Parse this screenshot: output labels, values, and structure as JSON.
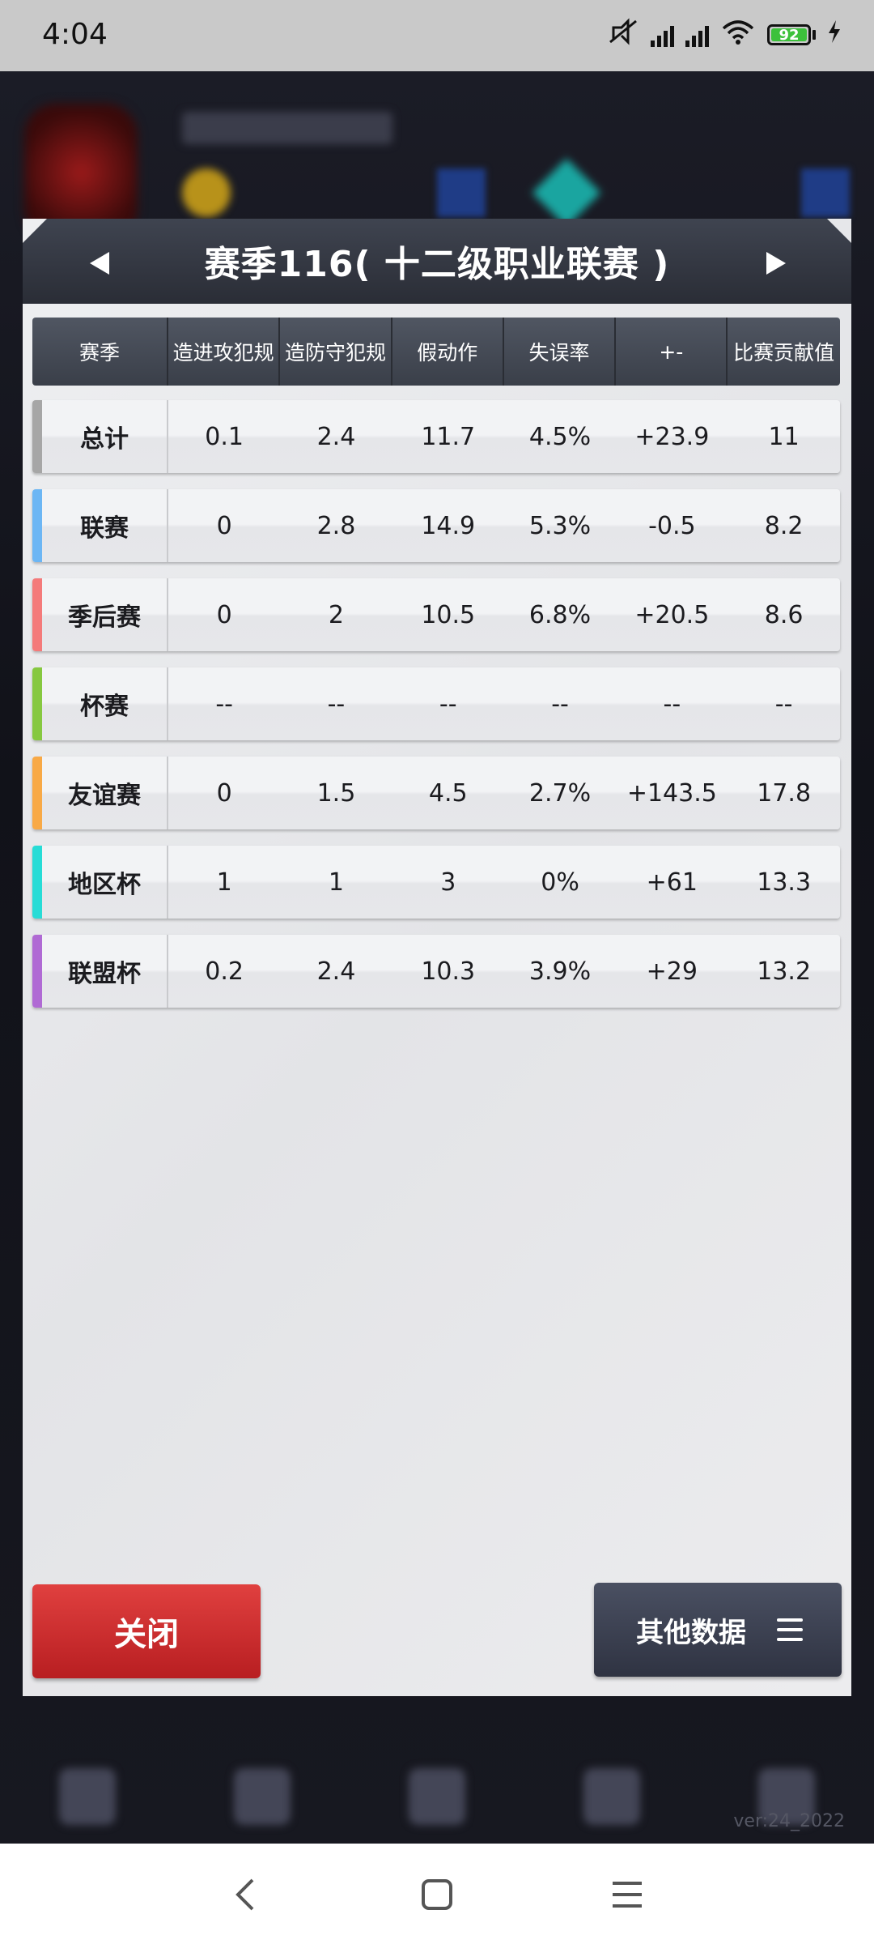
{
  "status_bar": {
    "time": "4:04",
    "battery": "92"
  },
  "background": {
    "version": "ver:24_2022"
  },
  "dialog": {
    "title": "赛季116( 十二级职业联赛 )",
    "columns": [
      "赛季",
      "造进攻犯规",
      "造防守犯规",
      "假动作",
      "失误率",
      "+-",
      "比赛贡献值"
    ],
    "rows": [
      {
        "label": "总计",
        "color": "#a6a6a6",
        "values": [
          "0.1",
          "2.4",
          "11.7",
          "4.5%",
          "+23.9",
          "11"
        ]
      },
      {
        "label": "联赛",
        "color": "#6cb6f4",
        "values": [
          "0",
          "2.8",
          "14.9",
          "5.3%",
          "-0.5",
          "8.2"
        ]
      },
      {
        "label": "季后赛",
        "color": "#f47a7a",
        "values": [
          "0",
          "2",
          "10.5",
          "6.8%",
          "+20.5",
          "8.6"
        ]
      },
      {
        "label": "杯赛",
        "color": "#86c840",
        "values": [
          "--",
          "--",
          "--",
          "--",
          "--",
          "--"
        ]
      },
      {
        "label": "友谊赛",
        "color": "#f8a946",
        "values": [
          "0",
          "1.5",
          "4.5",
          "2.7%",
          "+143.5",
          "17.8"
        ]
      },
      {
        "label": "地区杯",
        "color": "#27dcd6",
        "values": [
          "1",
          "1",
          "3",
          "0%",
          "+61",
          "13.3"
        ]
      },
      {
        "label": "联盟杯",
        "color": "#b06ad4",
        "values": [
          "0.2",
          "2.4",
          "10.3",
          "3.9%",
          "+29",
          "13.2"
        ]
      }
    ],
    "close_label": "关闭",
    "other_label": "其他数据"
  },
  "icons": {
    "prev": "triangle-left-icon",
    "next": "triangle-right-icon",
    "menu": "hamburger-menu-icon"
  },
  "colors": {
    "close_button": "#d03030",
    "other_button": "#3c4152",
    "header": "#353943"
  }
}
